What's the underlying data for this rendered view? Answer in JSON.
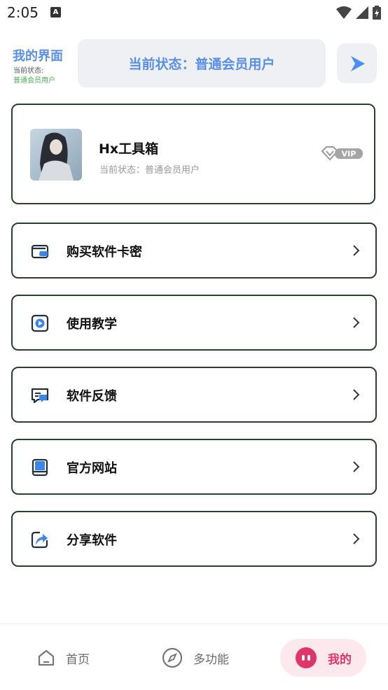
{
  "status_bar": {
    "time": "2:05",
    "a_icon": "A"
  },
  "header": {
    "title": "我的界面",
    "sub_label": "当前状态:",
    "sub_value": "普通会员用户",
    "pill_text": "当前状态：普通会员用户"
  },
  "profile": {
    "name": "Hx工具箱",
    "status": "当前状态：普通会员用户",
    "badge": "VIP"
  },
  "menu": [
    {
      "label": "购买软件卡密",
      "icon": "wallet-icon"
    },
    {
      "label": "使用教学",
      "icon": "video-icon"
    },
    {
      "label": "软件反馈",
      "icon": "feedback-icon"
    },
    {
      "label": "官方网站",
      "icon": "book-icon"
    },
    {
      "label": "分享软件",
      "icon": "share-icon"
    }
  ],
  "bottom_nav": {
    "home": "首页",
    "multi": "多功能",
    "mine": "我的"
  },
  "colors": {
    "accent_blue": "#5a8fe8",
    "active_pink": "#e0356a",
    "card_border": "#27412a"
  }
}
